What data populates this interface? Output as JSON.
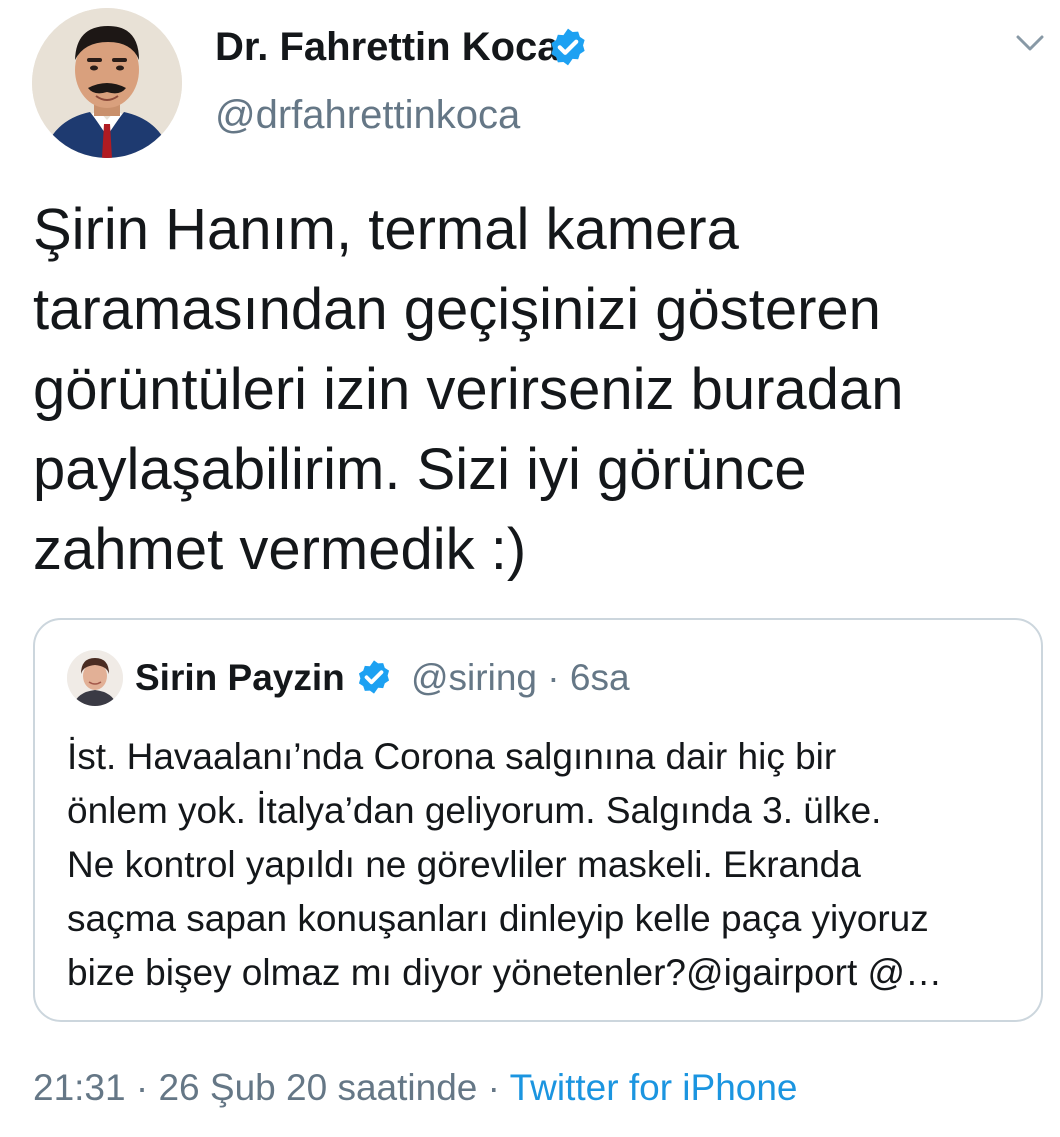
{
  "author": {
    "name": "Dr. Fahrettin Koca",
    "handle": "@drfahrettinkoca",
    "verified_icon": "verified-badge-icon",
    "avatar": "author-avatar"
  },
  "menu_icon": "chevron-down-icon",
  "tweet": {
    "text": "Şirin Hanım, termal kamera\ntaramasından geçişinizi gösteren\ngörüntüleri izin verirseniz buradan\npaylaşabilirim. Sizi iyi görünce\nzahmet vermedik :)"
  },
  "quoted_tweet": {
    "name": "Sirin Payzin",
    "handle": "@siring",
    "separator": "·",
    "time": "6sa",
    "text": "İst. Havaalanı’nda Corona salgınına dair hiç bir\nönlem yok. İtalya’dan geliyorum. Salgında 3. ülke.\nNe kontrol yapıldı ne görevliler maskeli. Ekranda\nsaçma sapan konuşanları dinleyip kelle paça yiyoruz\nbize bişey olmaz mı diyor yönetenler?@igairport @…"
  },
  "footer": {
    "time": "21:31",
    "separator": "·",
    "date": "26 Şub 20 saatinde",
    "separator2": "·",
    "source": "Twitter for iPhone"
  },
  "colors": {
    "verified": "#1da1f2",
    "link": "#1b95e0",
    "secondary_text": "#657786",
    "border": "#ccd6dd"
  }
}
